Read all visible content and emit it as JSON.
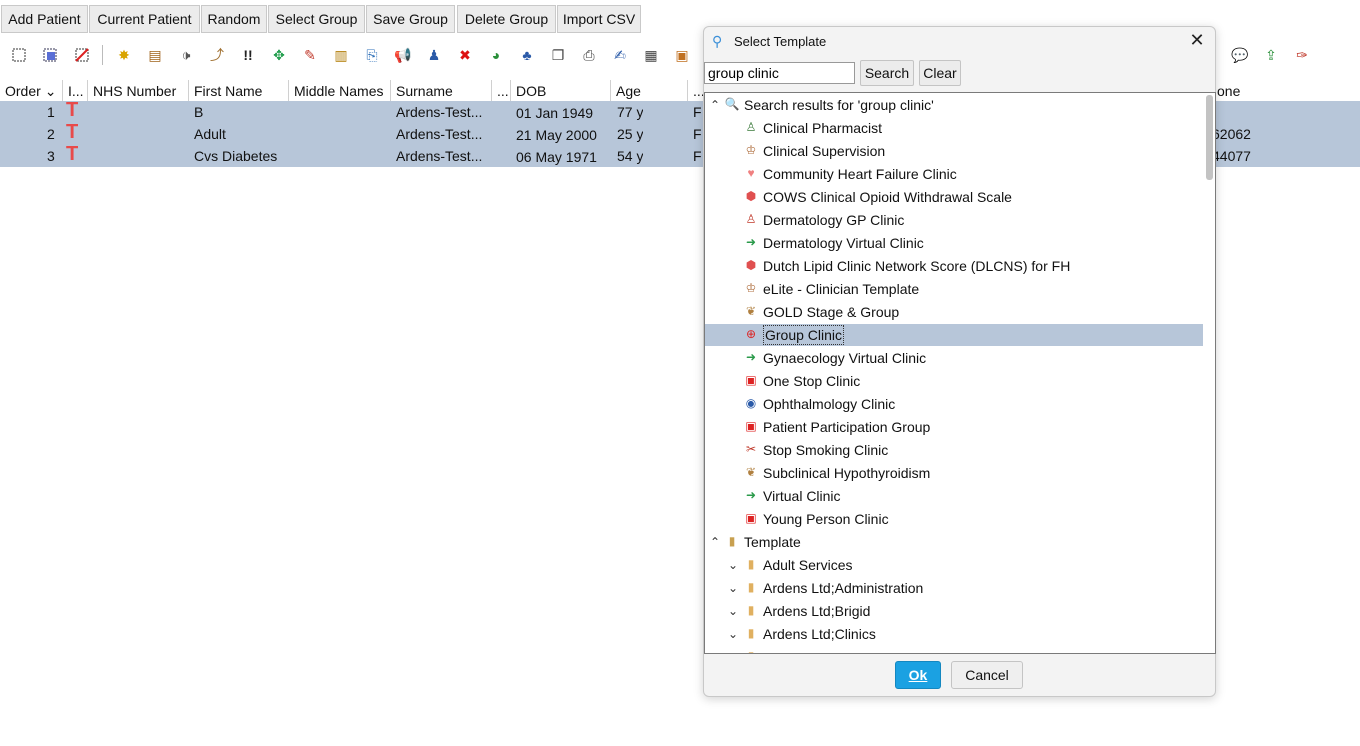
{
  "top_buttons": [
    "Add Patient",
    "Current Patient",
    "Random",
    "Select Group",
    "Save Group",
    "Delete Group",
    "Import CSV"
  ],
  "table": {
    "headers": [
      "Order",
      "I...",
      "NHS Number",
      "First Name",
      "Middle Names",
      "Surname",
      "...",
      "DOB",
      "Age",
      "...",
      "one"
    ],
    "sort_indicator": "⌄",
    "rows": [
      {
        "order": "1",
        "flag": "T",
        "first": "B",
        "surname": "Ardens-Test...",
        "dob": "01 Jan 1949",
        "age": "77 y",
        "sex": "F",
        "phone": ""
      },
      {
        "order": "2",
        "flag": "T",
        "first": "Adult",
        "surname": "Ardens-Test...",
        "dob": "21 May 2000",
        "age": "25 y",
        "sex": "F",
        "phone": "62062"
      },
      {
        "order": "3",
        "flag": "T",
        "first": "Cvs Diabetes",
        "surname": "Ardens-Test...",
        "dob": "06 May 1971",
        "age": "54 y",
        "sex": "F",
        "phone": "44077"
      }
    ]
  },
  "dialog": {
    "title": "Select Template",
    "search_value": "group clinic",
    "search_button": "Search",
    "clear_button": "Clear",
    "results_header": "Search results for 'group clinic'",
    "results": [
      "Clinical Pharmacist",
      "Clinical Supervision",
      "Community Heart Failure Clinic",
      "COWS Clinical Opioid Withdrawal Scale",
      "Dermatology GP Clinic",
      "Dermatology Virtual Clinic",
      "Dutch Lipid Clinic Network Score (DLCNS) for FH",
      "eLite - Clinician Template",
      "GOLD Stage & Group",
      "Group Clinic",
      "Gynaecology Virtual Clinic",
      "One Stop Clinic",
      "Ophthalmology Clinic",
      "Patient Participation Group",
      "Stop Smoking Clinic",
      "Subclinical Hypothyroidism",
      "Virtual Clinic",
      "Young Person Clinic"
    ],
    "selected": "Group Clinic",
    "template_header": "Template",
    "folders": [
      "Adult Services",
      "Ardens Ltd;Administration",
      "Ardens Ltd;Brigid",
      "Ardens Ltd;Clinics"
    ],
    "ok_label": "Ok",
    "cancel_label": "Cancel"
  }
}
